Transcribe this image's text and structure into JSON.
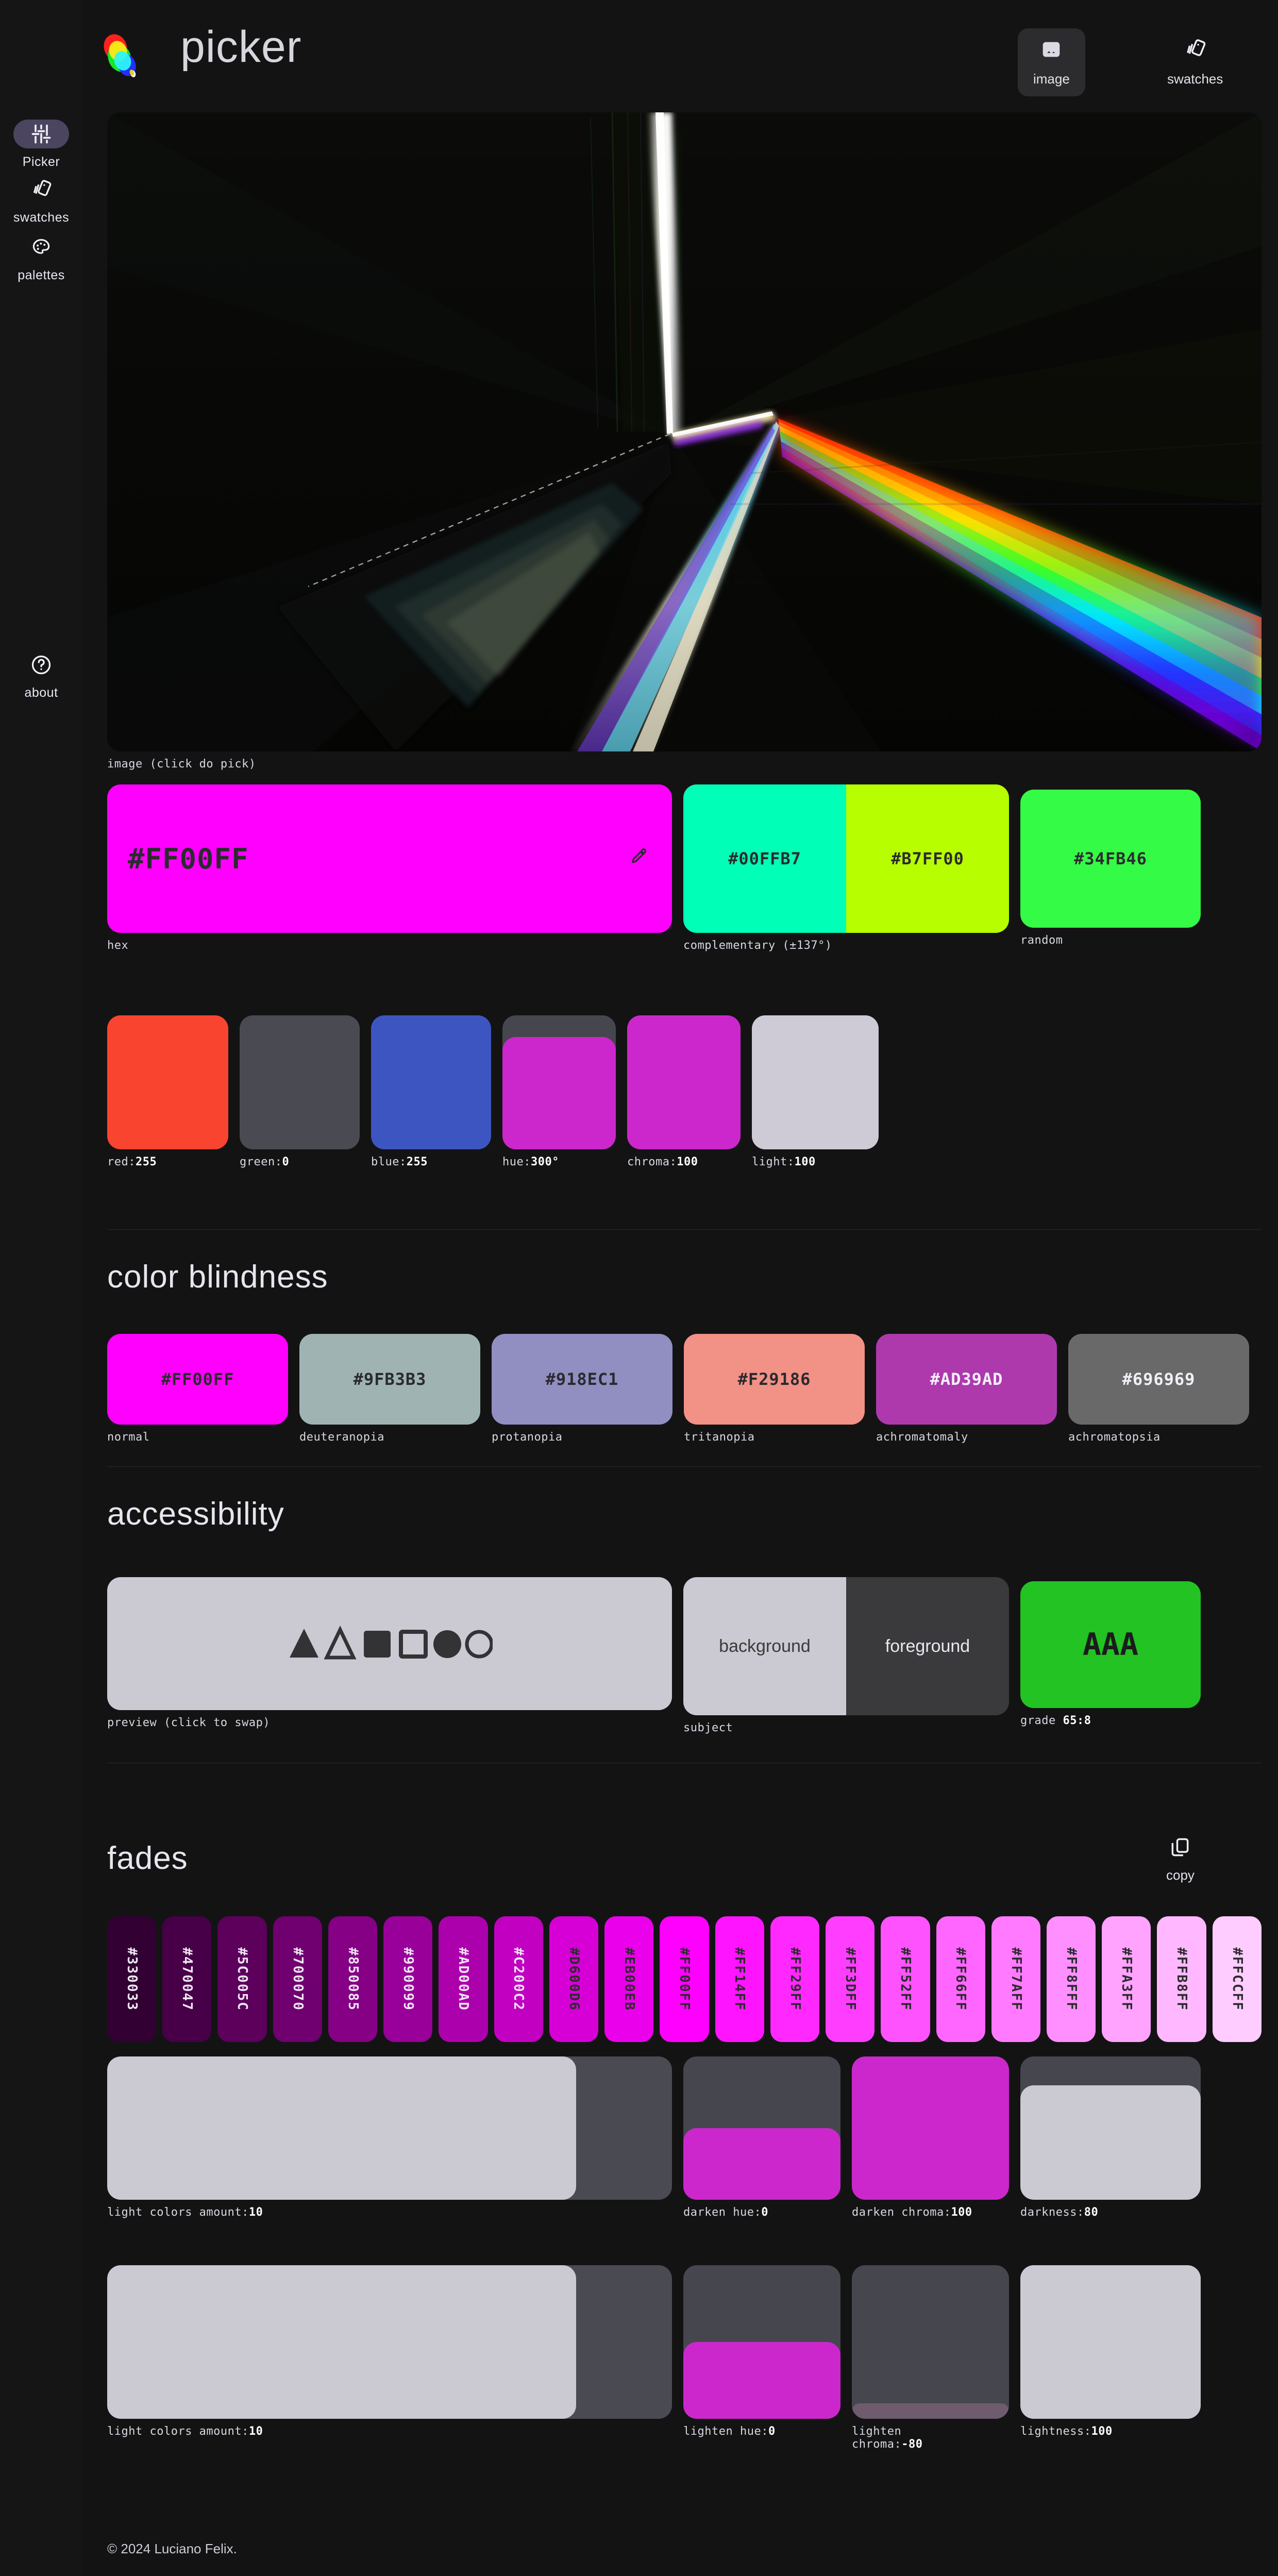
{
  "app": {
    "brand": "picker",
    "footer": "© 2024 Luciano Felix."
  },
  "header": {
    "buttons": [
      {
        "label": "image",
        "icon": "image-icon",
        "selected": true
      },
      {
        "label": "swatches",
        "icon": "swatches-icon",
        "selected": false
      }
    ]
  },
  "sidebar": {
    "items": [
      {
        "label": "Picker",
        "icon": "sliders-icon",
        "active": true
      },
      {
        "label": "swatches",
        "icon": "swatches-icon",
        "active": false
      },
      {
        "label": "palettes",
        "icon": "palette-icon",
        "active": false
      },
      {
        "label": "about",
        "icon": "question-circle-icon",
        "active": false
      }
    ]
  },
  "hero": {
    "caption": "image (click do pick)"
  },
  "primary": {
    "hex": "#FF00FF",
    "caption": "hex",
    "eyedropper": "eyedropper-icon"
  },
  "complementary": {
    "caption": "complementary (±137°)",
    "colors": [
      "#00FFB7",
      "#B7FF00"
    ]
  },
  "random": {
    "caption": "random",
    "hex": "#34FB46"
  },
  "channels": [
    {
      "label": "red",
      "value": "255",
      "caption": "red:255",
      "track": "#F9442F",
      "fill": "#F9442F",
      "pct": 100
    },
    {
      "label": "green",
      "value": "0",
      "caption": "green:0",
      "track": "#4A4A52",
      "fill": "#4A4A52",
      "pct": 0
    },
    {
      "label": "blue",
      "value": "255",
      "caption": "blue:255",
      "track": "#3C55C0",
      "fill": "#3C55C0",
      "pct": 100
    },
    {
      "label": "hue",
      "value": "300°",
      "caption": "hue:300°",
      "track": "#46464E",
      "fill": "#CC27CC",
      "pct": 84
    },
    {
      "label": "chroma",
      "value": "100",
      "caption": "chroma:100",
      "track": "#46464E",
      "fill": "#CC27CC",
      "pct": 100
    },
    {
      "label": "light",
      "value": "100",
      "caption": "light:100",
      "track": "#CECBD6",
      "fill": "#CECBD6",
      "pct": 100
    }
  ],
  "color_blindness": {
    "title": "color blindness",
    "items": [
      {
        "caption": "normal",
        "hex": "#FF00FF",
        "text": "#2a2a2e"
      },
      {
        "caption": "deuteranopia",
        "hex": "#9FB3B3",
        "text": "#2a2a2e"
      },
      {
        "caption": "protanopia",
        "hex": "#918EC1",
        "text": "#2a2a2e"
      },
      {
        "caption": "tritanopia",
        "hex": "#F29186",
        "text": "#2a2a2e"
      },
      {
        "caption": "achromatomaly",
        "hex": "#AD39AD",
        "text": "#f2f0f6"
      },
      {
        "caption": "achromatopsia",
        "hex": "#696969",
        "text": "#f2f0f6"
      }
    ]
  },
  "accessibility": {
    "title": "accessibility",
    "preview": {
      "caption": "preview (click to swap)",
      "bg": "#CBC9D1",
      "fg": "#333336",
      "shapes": [
        "triangle-filled",
        "triangle-outline",
        "square-filled",
        "square-outline",
        "circle-filled",
        "circle-outline"
      ]
    },
    "subject": {
      "caption": "subject",
      "background_label": "background",
      "foreground_label": "foreground",
      "bg": "#CBC9D1",
      "fg": "#3A3A3C"
    },
    "grade": {
      "caption": "grade 65:8",
      "value": "AAA",
      "hex": "#22C322",
      "text": "#1b1b1d"
    }
  },
  "fades": {
    "title": "fades",
    "copy_label": "copy",
    "copy_icon": "copy-icon",
    "chips": [
      {
        "hex": "#330033",
        "text": "#efe6f4"
      },
      {
        "hex": "#470047",
        "text": "#efe6f4"
      },
      {
        "hex": "#5C005C",
        "text": "#efe6f4"
      },
      {
        "hex": "#700070",
        "text": "#efe6f4"
      },
      {
        "hex": "#850085",
        "text": "#efe6f4"
      },
      {
        "hex": "#990099",
        "text": "#efe6f4"
      },
      {
        "hex": "#AD00AD",
        "text": "#efe6f4"
      },
      {
        "hex": "#C200C2",
        "text": "#efe6f4"
      },
      {
        "hex": "#D600D6",
        "text": "#2b2b2e"
      },
      {
        "hex": "#EB00EB",
        "text": "#2b2b2e"
      },
      {
        "hex": "#FF00FF",
        "text": "#2b2b2e"
      },
      {
        "hex": "#FF14FF",
        "text": "#2b2b2e"
      },
      {
        "hex": "#FF29FF",
        "text": "#2b2b2e"
      },
      {
        "hex": "#FF3DFF",
        "text": "#2b2b2e"
      },
      {
        "hex": "#FF52FF",
        "text": "#2b2b2e"
      },
      {
        "hex": "#FF66FF",
        "text": "#2b2b2e"
      },
      {
        "hex": "#FF7AFF",
        "text": "#2b2b2e"
      },
      {
        "hex": "#FF8FFF",
        "text": "#2b2b2e"
      },
      {
        "hex": "#FFA3FF",
        "text": "#2b2b2e"
      },
      {
        "hex": "#FFB8FF",
        "text": "#2b2b2e"
      },
      {
        "hex": "#FFCCFF",
        "text": "#2b2b2e"
      }
    ]
  },
  "darken": {
    "amount": {
      "caption": "light colors amount:10",
      "track": "#4A4A52",
      "fill": "#CBC9D1",
      "pct": 100,
      "fill_width_pct": 83
    },
    "hue": {
      "caption": "darken hue:0",
      "track": "#46464E",
      "fill": "#CC27CC",
      "pct": 50
    },
    "chroma": {
      "caption": "darken chroma:100",
      "track": "#46464E",
      "fill": "#CC27CC",
      "pct": 100
    },
    "darkness": {
      "caption": "darkness:80",
      "track": "#46464E",
      "fill": "#CBC9D1",
      "pct": 80
    }
  },
  "lighten": {
    "amount": {
      "caption": "light colors amount:10",
      "track": "#4A4A52",
      "fill": "#CBC9D1",
      "pct": 100,
      "fill_width_pct": 83
    },
    "hue": {
      "caption": "lighten hue:0",
      "track": "#46464E",
      "fill": "#CC27CC",
      "pct": 50
    },
    "chroma": {
      "caption": "lighten chroma:-80",
      "track": "#46464E",
      "fill": "#6E5B6E",
      "pct": 10
    },
    "lightness": {
      "caption": "lightness:100",
      "track": "#CBC9D1",
      "fill": "#CBC9D1",
      "pct": 100
    }
  }
}
